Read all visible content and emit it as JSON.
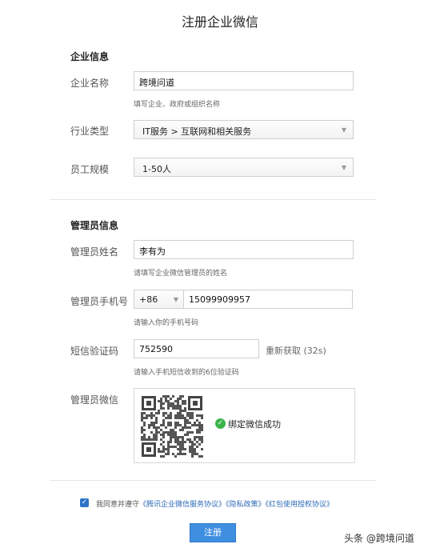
{
  "page": {
    "title": "注册企业微信"
  },
  "company": {
    "section_title": "企业信息",
    "name_label": "企业名称",
    "name_value": "跨境问道",
    "name_hint": "填写企业、政府或组织名称",
    "industry_label": "行业类型",
    "industry_value": "IT服务 > 互联网和相关服务",
    "size_label": "员工规模",
    "size_value": "1-50人"
  },
  "admin": {
    "section_title": "管理员信息",
    "name_label": "管理员姓名",
    "name_value": "李有为",
    "name_hint": "请填写企业微信管理员的姓名",
    "phone_label": "管理员手机号",
    "country_code": "+86",
    "phone_value": "15099909957",
    "phone_hint": "请输入你的手机号码",
    "sms_label": "短信验证码",
    "sms_value": "752590",
    "resend_label": "重新获取 (32s)",
    "sms_hint": "请输入手机短信收到的6位验证码",
    "wechat_label": "管理员微信",
    "bind_status": "绑定微信成功"
  },
  "agreement": {
    "prefix": "我同意并遵守",
    "link1": "《腾讯企业微信服务协议》",
    "link2": "《隐私政策》",
    "link3": "《红包使用授权协议》"
  },
  "submit_label": "注册",
  "watermark": "头条 @跨境问道",
  "colors": {
    "accent": "#3f8fe0",
    "success": "#3cb44b",
    "link": "#2e6bb8"
  }
}
